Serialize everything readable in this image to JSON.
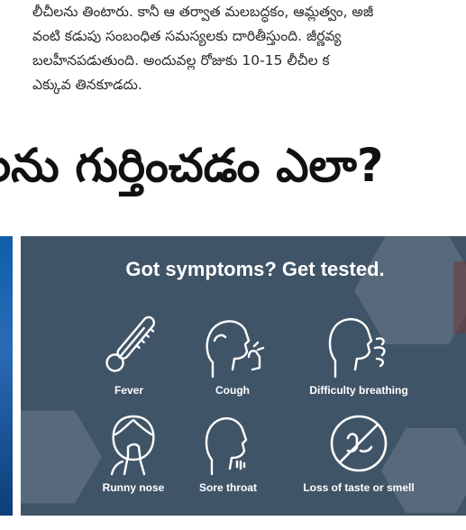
{
  "article": {
    "paragraph_lines": [
      "లీచీలను తింటారు. కానీ ఆ తర్వాత మలబద్ధకం, ఆమ్లత్వం, అజీ",
      "వంటి కడుపు సంబంధిత సమస్యలకు దారితీస్తుంది. జీర్ణవ్య",
      "బలహీనపడుతుంది. అందువల్ల రోజుకు 10-15 లీచీల క",
      "ఎక్కువ తినకూడదు."
    ],
    "heading": "లను గుర్తించడం ఎలా?"
  },
  "infographic": {
    "title": "Got symptoms? Get tested.",
    "symptoms": [
      {
        "label": "Fever",
        "icon": "thermometer-icon"
      },
      {
        "label": "Cough",
        "icon": "cough-icon"
      },
      {
        "label": "Difficulty breathing",
        "icon": "breathing-icon"
      },
      {
        "label": "Runny nose",
        "icon": "runny-nose-icon"
      },
      {
        "label": "Sore throat",
        "icon": "sore-throat-icon"
      },
      {
        "label": "Loss of taste or smell",
        "icon": "no-smell-icon"
      }
    ],
    "colors": {
      "card_background": "#405467",
      "text": "#ffffff"
    }
  }
}
